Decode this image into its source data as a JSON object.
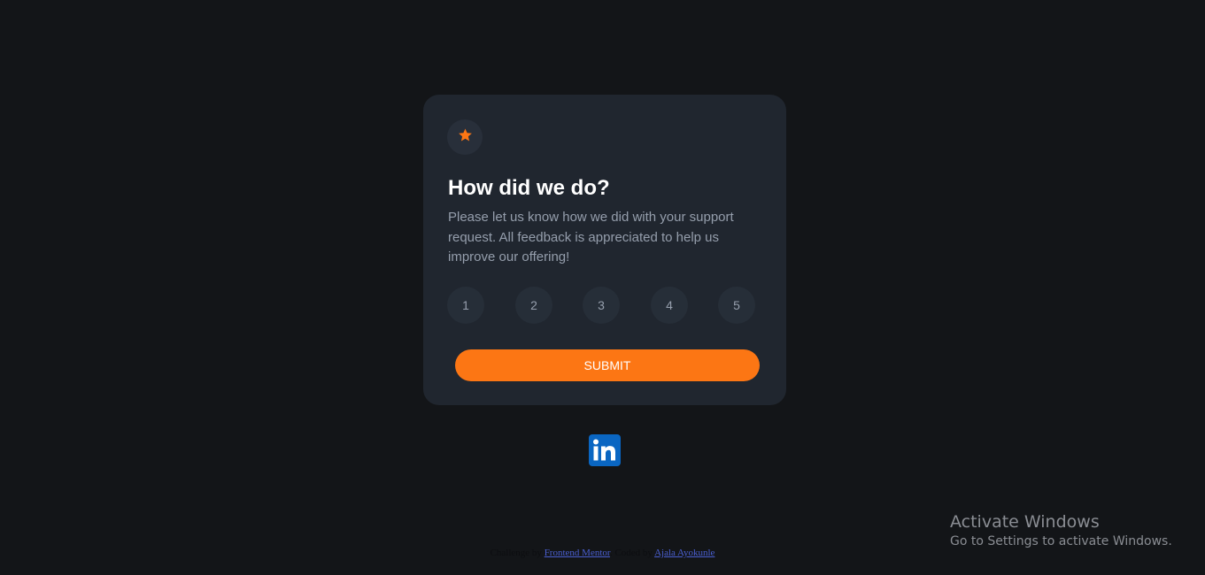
{
  "card": {
    "title": "How did we do?",
    "description": "Please let us know how we did with your support request. All feedback is appreciated to help us improve our offering!",
    "icon": "star-icon",
    "ratings": [
      "1",
      "2",
      "3",
      "4",
      "5"
    ],
    "submit_label": "SUBMIT"
  },
  "social": {
    "icon": "linkedin-icon"
  },
  "footer": {
    "challenge_prefix": "Challenge by",
    "challenge_link": "Frontend Mentor",
    "coded_prefix": ". Coded by",
    "coded_link": "Ajala Ayokunle"
  },
  "watermark": {
    "title": "Activate Windows",
    "subtitle": "Go to Settings to activate Windows."
  },
  "colors": {
    "background": "#131518",
    "card": "#20262f",
    "accent": "#fc7614",
    "rating_bg": "#262e38",
    "text_muted": "#959eac",
    "linkedin": "#0a66c2"
  }
}
